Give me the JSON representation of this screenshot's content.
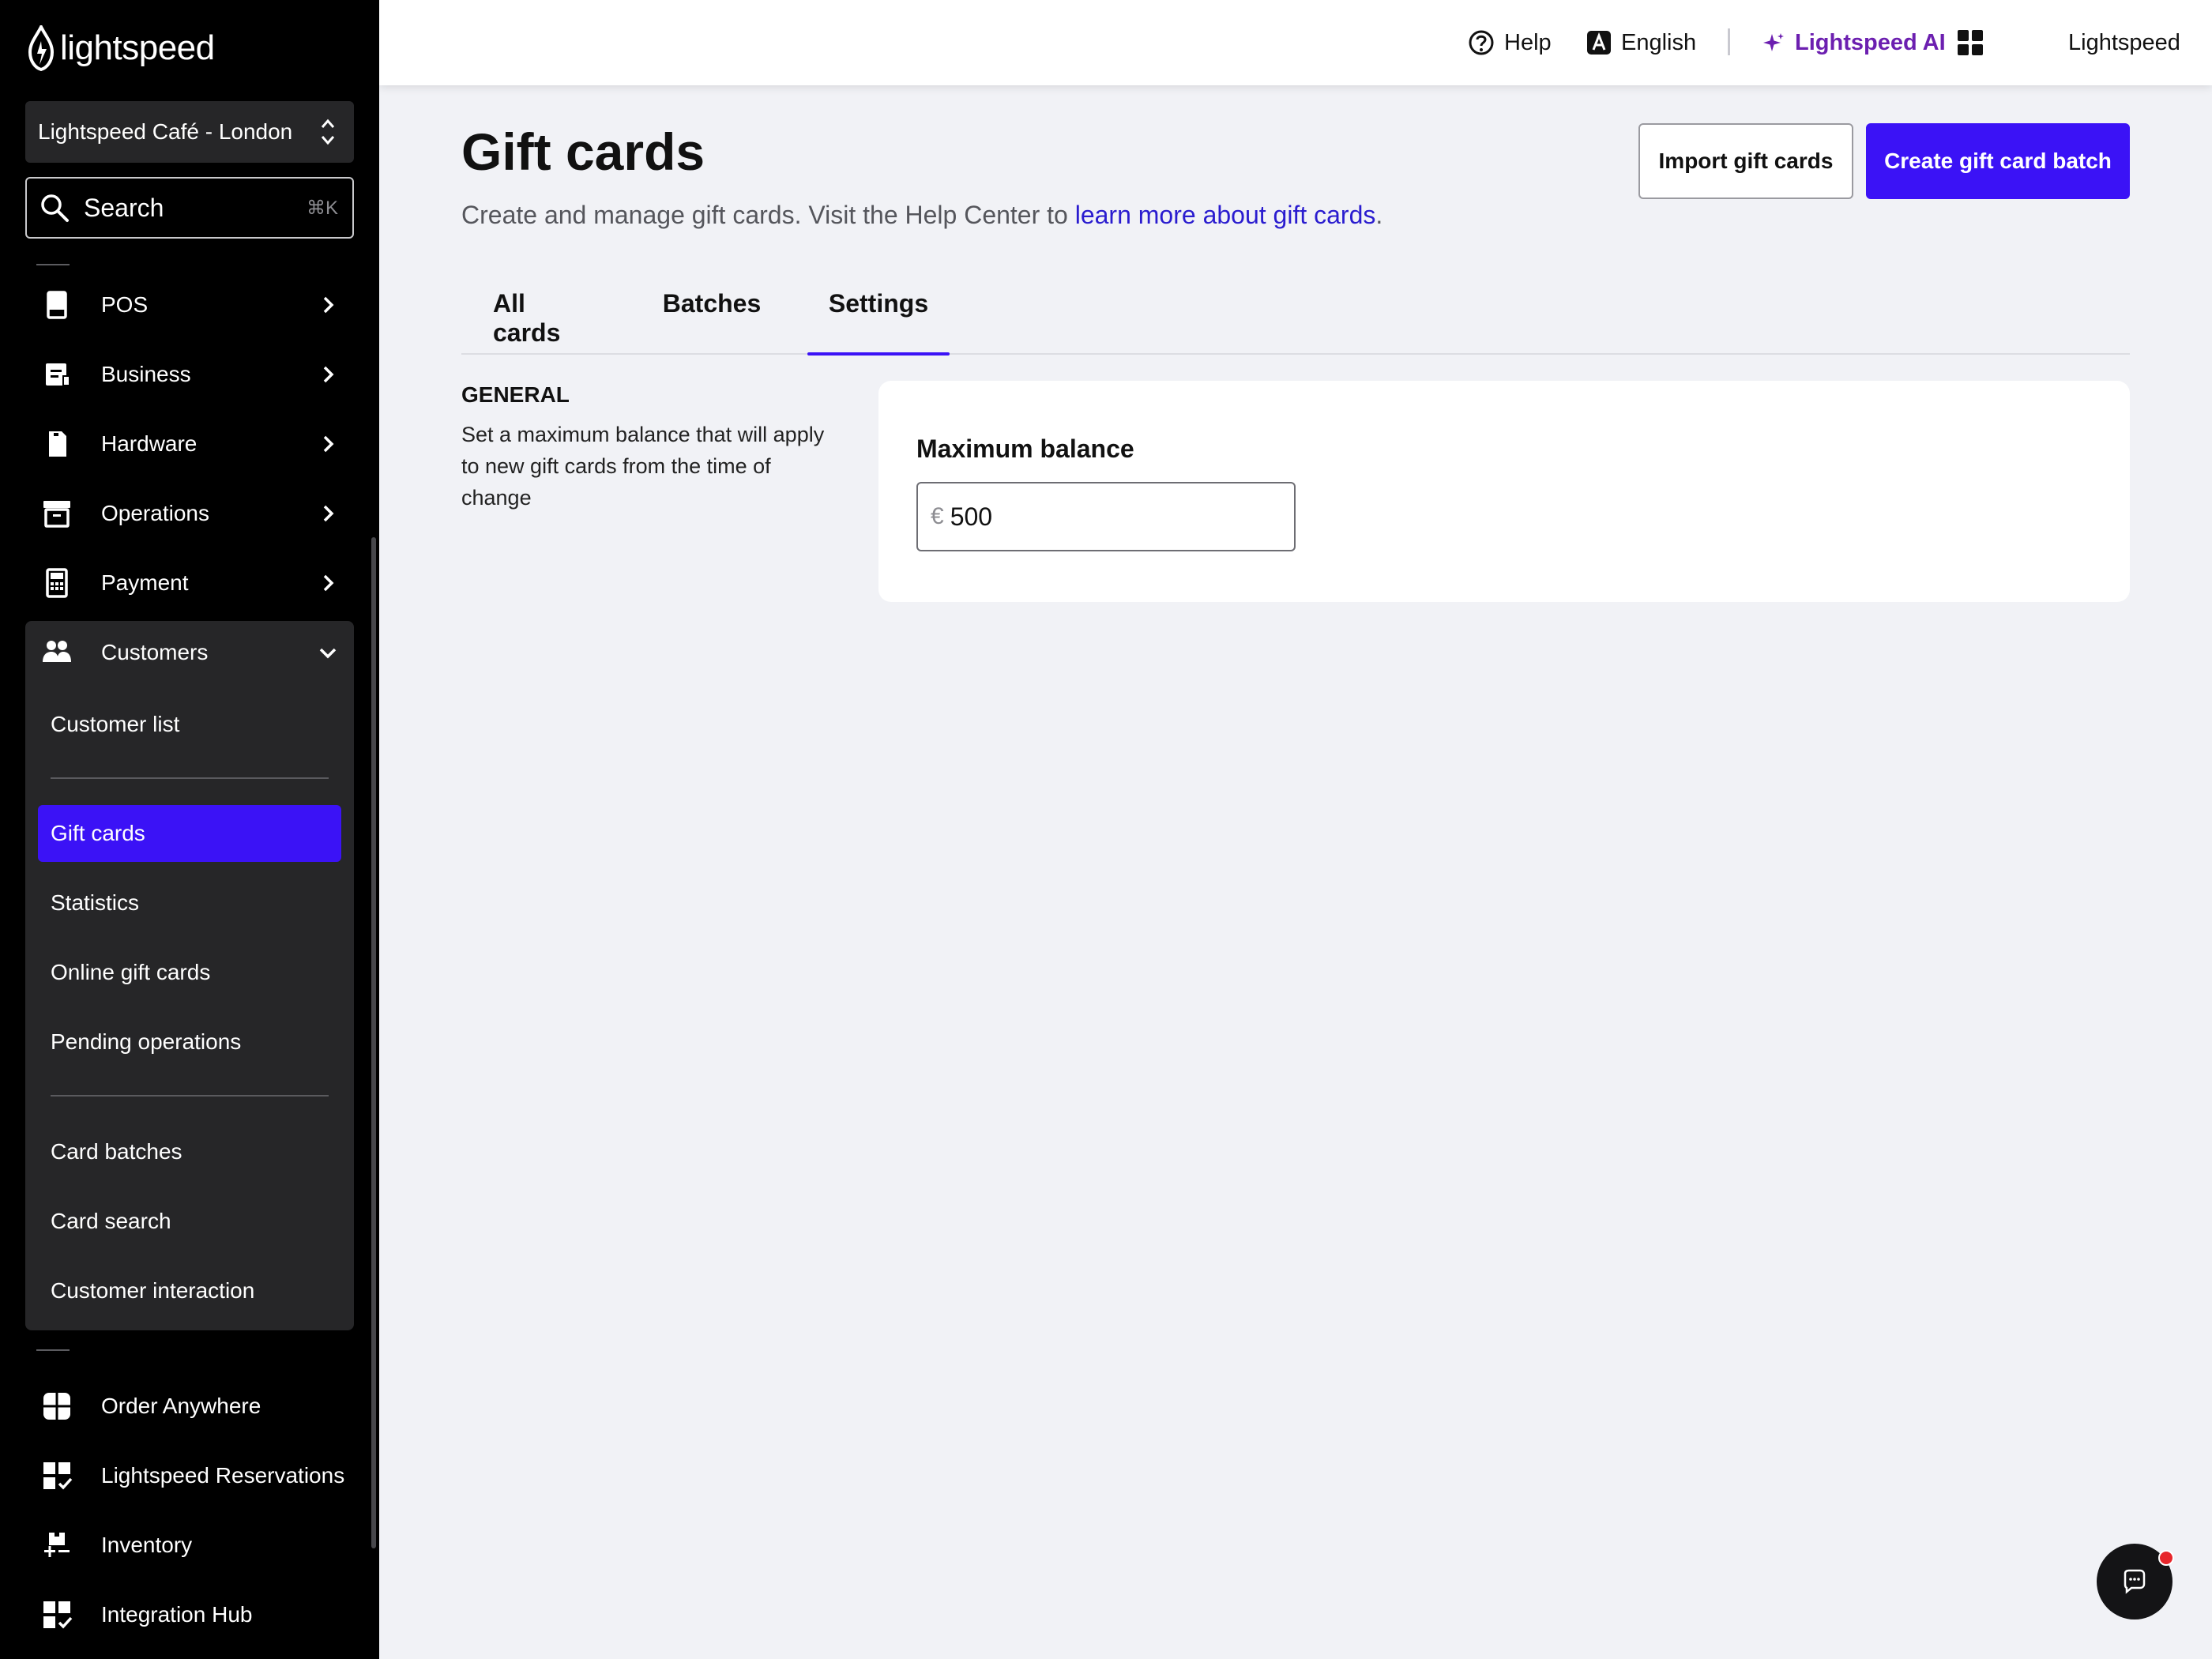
{
  "brand": {
    "logo_text": "lightspeed"
  },
  "sidebar": {
    "location": "Lightspeed Café - London",
    "search": {
      "placeholder": "Search",
      "shortcut": "⌘K"
    },
    "items": [
      {
        "label": "POS",
        "icon": "pos-terminal-icon"
      },
      {
        "label": "Business",
        "icon": "business-icon"
      },
      {
        "label": "Hardware",
        "icon": "hardware-icon"
      },
      {
        "label": "Operations",
        "icon": "operations-icon"
      },
      {
        "label": "Payment",
        "icon": "payment-icon"
      },
      {
        "label": "Customers",
        "icon": "customers-icon",
        "expanded": true
      }
    ],
    "customers_sub": [
      "Customer list",
      "Gift cards",
      "Statistics",
      "Online gift cards",
      "Pending operations",
      "Card batches",
      "Card search",
      "Customer interaction"
    ],
    "active_sub": "Gift cards",
    "bottom_items": [
      {
        "label": "Order Anywhere",
        "icon": "order-anywhere-icon"
      },
      {
        "label": "Lightspeed Reservations",
        "icon": "reservations-icon"
      },
      {
        "label": "Inventory",
        "icon": "inventory-icon"
      },
      {
        "label": "Integration Hub",
        "icon": "integration-hub-icon"
      }
    ]
  },
  "topbar": {
    "help": "Help",
    "language": "English",
    "ai": "Lightspeed AI",
    "account": "Lightspeed"
  },
  "page": {
    "title": "Gift cards",
    "subtitle_prefix": "Create and manage gift cards. Visit the Help Center to ",
    "subtitle_link": "learn more about gift cards",
    "subtitle_suffix": ".",
    "import_button": "Import gift cards",
    "create_button": "Create gift card batch",
    "tabs": [
      "All cards",
      "Batches",
      "Settings"
    ],
    "active_tab": "Settings"
  },
  "settings": {
    "section_title": "GENERAL",
    "section_description": "Set a maximum balance that will apply to new gift cards from the time of change",
    "field_label": "Maximum balance",
    "currency_symbol": "€",
    "field_value": "500"
  },
  "colors": {
    "accent": "#3b12f6",
    "ai_purple": "#6c1fb0",
    "sidebar_bg": "#000000",
    "panel_bg": "#262628",
    "page_bg": "#f1f2f6",
    "link": "#2a1ccf",
    "notification": "#e7262b"
  }
}
